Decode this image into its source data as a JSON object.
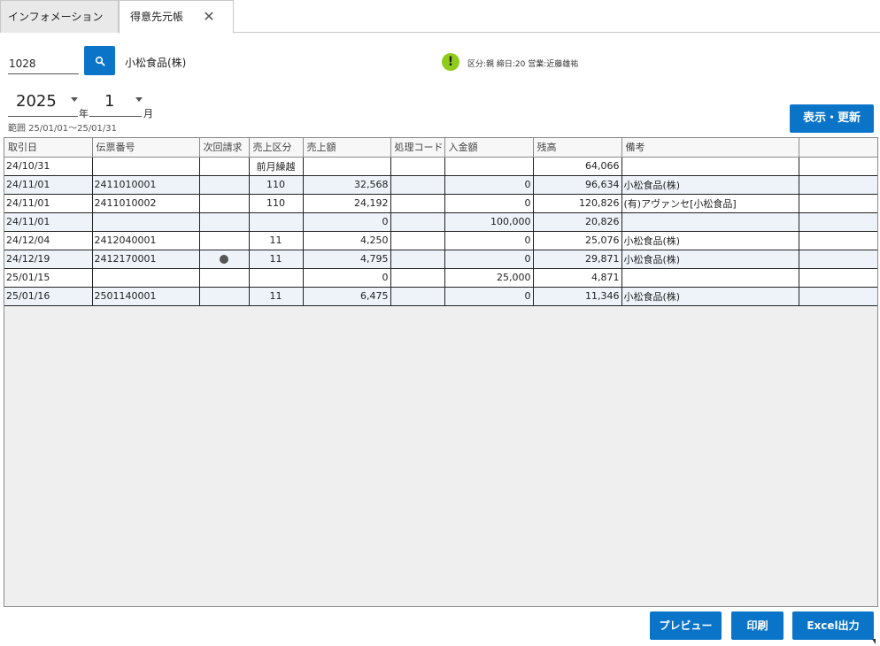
{
  "tabs": [
    {
      "label": "インフォメーション"
    },
    {
      "label": "得意先元帳"
    }
  ],
  "customer": {
    "code": "1028",
    "name": "小松食品(株)",
    "info": "区分:親 締日:20 営業:近藤雄祐"
  },
  "period": {
    "year": "2025",
    "year_unit": "年",
    "month": "1",
    "month_unit": "月",
    "range": "範囲 25/01/01〜25/01/31"
  },
  "buttons": {
    "refresh": "表示・更新",
    "preview": "プレビュー",
    "print": "印刷",
    "excel": "Excel出力"
  },
  "table": {
    "columns": [
      "取引日",
      "伝票番号",
      "次回請求",
      "売上区分",
      "売上額",
      "処理コード",
      "入金額",
      "残高",
      "備考",
      ""
    ],
    "rows": [
      {
        "date": "24/10/31",
        "slip": "",
        "next": false,
        "kubun": "前月繰越",
        "sales": "",
        "code": "",
        "payment": "",
        "balance": "64,066",
        "note": ""
      },
      {
        "date": "24/11/01",
        "slip": "2411010001",
        "next": false,
        "kubun": "110",
        "sales": "32,568",
        "code": "",
        "payment": "0",
        "balance": "96,634",
        "note": "小松食品(株)"
      },
      {
        "date": "24/11/01",
        "slip": "2411010002",
        "next": false,
        "kubun": "110",
        "sales": "24,192",
        "code": "",
        "payment": "0",
        "balance": "120,826",
        "note": "(有)アヴァンセ[小松食品]"
      },
      {
        "date": "24/11/01",
        "slip": "",
        "next": false,
        "kubun": "",
        "sales": "0",
        "code": "",
        "payment": "100,000",
        "balance": "20,826",
        "note": ""
      },
      {
        "date": "24/12/04",
        "slip": "2412040001",
        "next": false,
        "kubun": "11",
        "sales": "4,250",
        "code": "",
        "payment": "0",
        "balance": "25,076",
        "note": "小松食品(株)"
      },
      {
        "date": "24/12/19",
        "slip": "2412170001",
        "next": true,
        "kubun": "11",
        "sales": "4,795",
        "code": "",
        "payment": "0",
        "balance": "29,871",
        "note": "小松食品(株)"
      },
      {
        "date": "25/01/15",
        "slip": "",
        "next": false,
        "kubun": "",
        "sales": "0",
        "code": "",
        "payment": "25,000",
        "balance": "4,871",
        "note": ""
      },
      {
        "date": "25/01/16",
        "slip": "2501140001",
        "next": false,
        "kubun": "11",
        "sales": "6,475",
        "code": "",
        "payment": "0",
        "balance": "11,346",
        "note": "小松食品(株)"
      }
    ]
  },
  "colors": {
    "accent": "#0a74c9",
    "warning": "#8fcb1b"
  }
}
